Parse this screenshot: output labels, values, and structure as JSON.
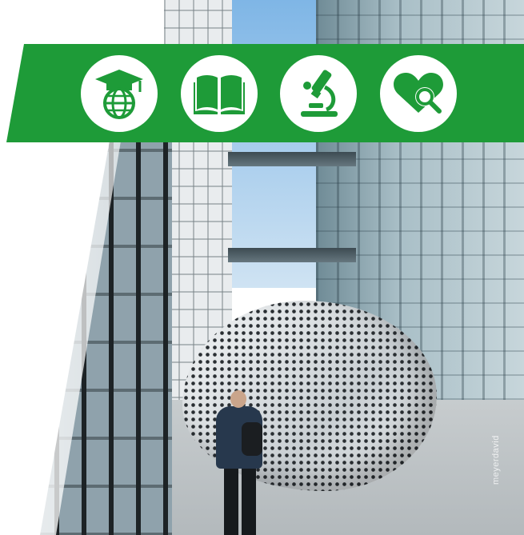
{
  "colors": {
    "banner_green": "#1e9b38",
    "icon_fill": "#1e9b38",
    "circle_white": "#ffffff"
  },
  "banner": {
    "icons": [
      {
        "name": "graduation-globe-icon"
      },
      {
        "name": "open-book-icon"
      },
      {
        "name": "microscope-icon"
      },
      {
        "name": "heart-search-icon"
      }
    ]
  },
  "photo": {
    "credit": "meyerdavid"
  }
}
